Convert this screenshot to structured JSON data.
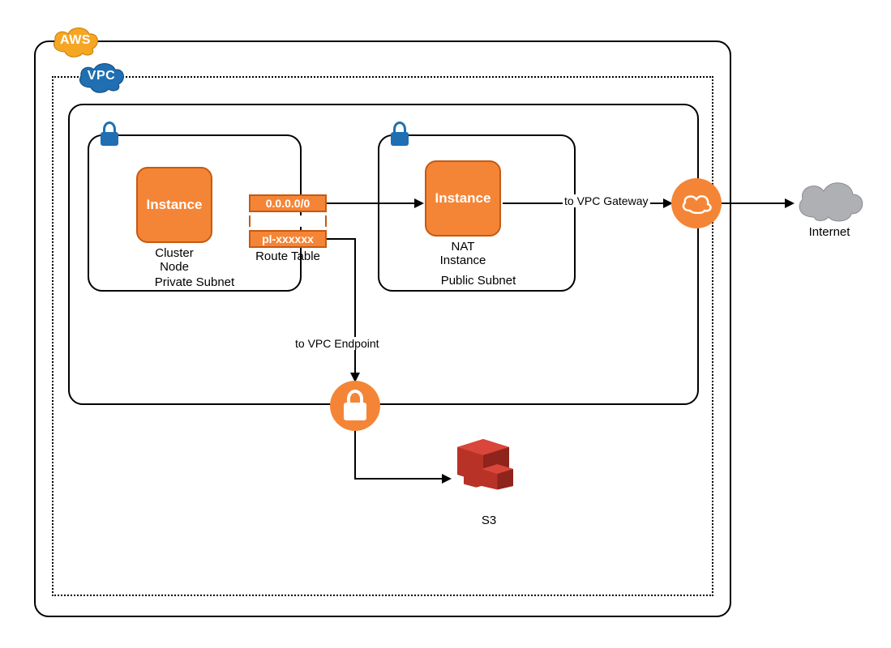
{
  "badges": {
    "aws": "AWS",
    "vpc": "VPC"
  },
  "subnets": {
    "private": {
      "label": "Private Subnet",
      "instance": {
        "tile": "Instance",
        "caption": "Cluster\nNode"
      }
    },
    "public": {
      "label": "Public Subnet",
      "instance": {
        "tile": "Instance",
        "caption": "NAT\nInstance"
      }
    }
  },
  "route_table": {
    "label": "Route Table",
    "entries": [
      "0.0.0.0/0",
      "pl-xxxxxx"
    ]
  },
  "edges": {
    "to_nat": "",
    "to_gateway": "to VPC Gateway",
    "to_endpoint": "to VPC Endpoint"
  },
  "services": {
    "s3": "S3",
    "internet": "Internet"
  },
  "colors": {
    "orange": "#f58536",
    "orange_border": "#c45a12",
    "vpc_blue": "#1f6fb2",
    "aws_orange": "#f5a623",
    "internet_gray": "#aeb0b3",
    "s3_red": "#b83227"
  }
}
